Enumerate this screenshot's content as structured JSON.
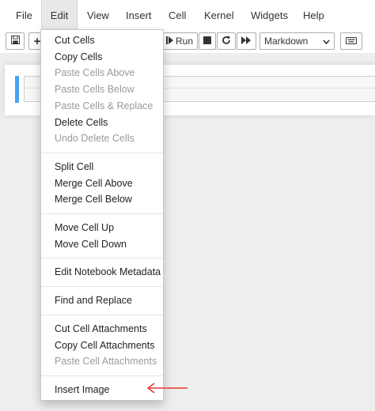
{
  "menubar": {
    "items": [
      "File",
      "Edit",
      "View",
      "Insert",
      "Cell",
      "Kernel",
      "Widgets",
      "Help"
    ]
  },
  "toolbar": {
    "save_icon": "floppy-disk-icon",
    "add_label": "+",
    "run_label": "Run",
    "cell_type_value": "Markdown",
    "keyboard_icon": "keyboard-icon"
  },
  "edit_menu": {
    "groups": [
      [
        {
          "label": "Cut Cells",
          "enabled": true
        },
        {
          "label": "Copy Cells",
          "enabled": true
        },
        {
          "label": "Paste Cells Above",
          "enabled": false
        },
        {
          "label": "Paste Cells Below",
          "enabled": false
        },
        {
          "label": "Paste Cells & Replace",
          "enabled": false
        },
        {
          "label": "Delete Cells",
          "enabled": true
        },
        {
          "label": "Undo Delete Cells",
          "enabled": false
        }
      ],
      [
        {
          "label": "Split Cell",
          "enabled": true
        },
        {
          "label": "Merge Cell Above",
          "enabled": true
        },
        {
          "label": "Merge Cell Below",
          "enabled": true
        }
      ],
      [
        {
          "label": "Move Cell Up",
          "enabled": true
        },
        {
          "label": "Move Cell Down",
          "enabled": true
        }
      ],
      [
        {
          "label": "Edit Notebook Metadata",
          "enabled": true
        }
      ],
      [
        {
          "label": "Find and Replace",
          "enabled": true
        }
      ],
      [
        {
          "label": "Cut Cell Attachments",
          "enabled": true
        },
        {
          "label": "Copy Cell Attachments",
          "enabled": true
        },
        {
          "label": "Paste Cell Attachments",
          "enabled": false
        }
      ],
      [
        {
          "label": "Insert Image",
          "enabled": true
        }
      ]
    ]
  },
  "annotation": {
    "arrow_color": "#e53935",
    "points_to": "Insert Image"
  },
  "colors": {
    "cell_selected_bar": "#42a5f5",
    "disabled_text": "#9a9a9a"
  }
}
